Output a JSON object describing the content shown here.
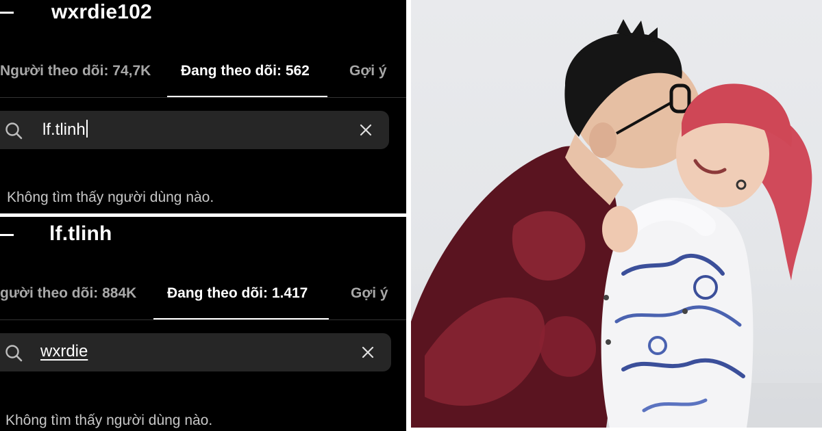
{
  "top_panel": {
    "username": "wxrdie102",
    "tabs": {
      "followers": "Người theo dõi: 74,7K",
      "following": "Đang theo dõi: 562",
      "suggested": "Gợi ý"
    },
    "search_value": "lf.tlinh",
    "empty_message": "Không tìm thấy người dùng nào."
  },
  "bottom_panel": {
    "username": "lf.tlinh",
    "tabs": {
      "followers": "gười theo dõi: 884K",
      "following": "Đang theo dõi: 1.417",
      "suggested": "Gợi ý"
    },
    "search_value": "wxrdie",
    "empty_message": "Không tìm thấy người dùng nào."
  },
  "icons": {
    "back": "back-arrow-icon",
    "search": "search-icon",
    "clear": "close-icon"
  },
  "colors": {
    "panel_background": "#000000",
    "search_background": "#262626",
    "inactive_tab": "#a8a8a8",
    "jacket_red": "#7a1f2e",
    "hair_pink": "#d9505e",
    "dragon_blue": "#3b4f9a"
  }
}
